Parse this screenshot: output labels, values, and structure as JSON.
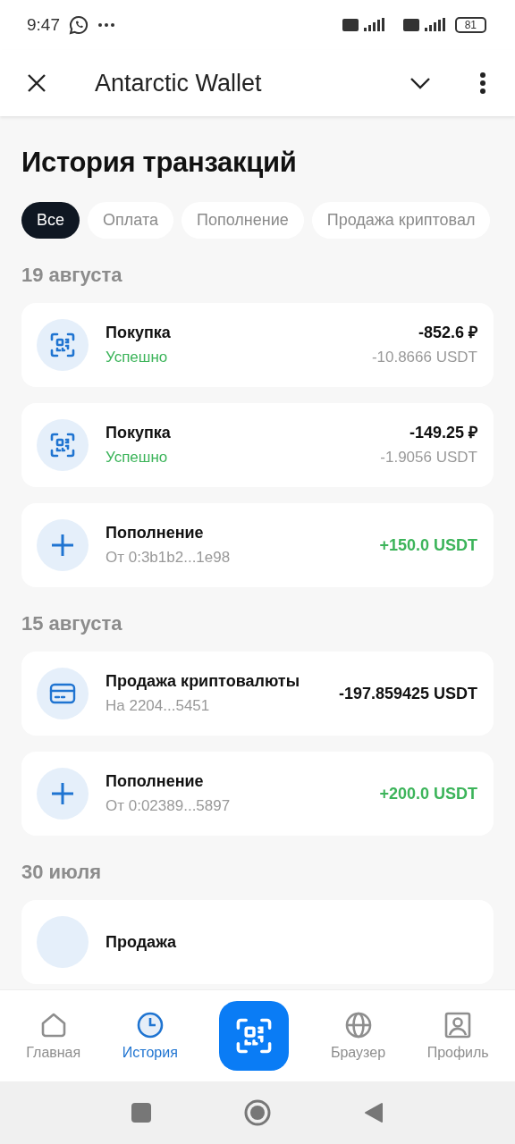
{
  "status_bar": {
    "time": "9:47",
    "battery": "81"
  },
  "app_bar": {
    "title": "Antarctic Wallet"
  },
  "page_title": "История транзакций",
  "filters": [
    {
      "label": "Все",
      "selected": true
    },
    {
      "label": "Оплата",
      "selected": false
    },
    {
      "label": "Пополнение",
      "selected": false
    },
    {
      "label": "Продажа криптовал",
      "selected": false
    }
  ],
  "groups": [
    {
      "date": "19 августа",
      "transactions": [
        {
          "kind": "scan",
          "title": "Покупка",
          "subtitle": "Успешно",
          "subtitle_success": true,
          "amount": "-852.6 ₽",
          "amount_positive": false,
          "secondary_amount": "-10.8666 USDT"
        },
        {
          "kind": "scan",
          "title": "Покупка",
          "subtitle": "Успешно",
          "subtitle_success": true,
          "amount": "-149.25 ₽",
          "amount_positive": false,
          "secondary_amount": "-1.9056 USDT"
        },
        {
          "kind": "plus",
          "title": "Пополнение",
          "subtitle": "От 0:3b1b2...1e98",
          "subtitle_success": false,
          "amount": "+150.0 USDT",
          "amount_positive": true
        }
      ]
    },
    {
      "date": "15 августа",
      "transactions": [
        {
          "kind": "card",
          "title": "Продажа криптовалюты",
          "subtitle": "На 2204...5451",
          "subtitle_success": false,
          "amount": "-197.859425 USDT",
          "amount_positive": false
        },
        {
          "kind": "plus",
          "title": "Пополнение",
          "subtitle": "От 0:02389...5897",
          "subtitle_success": false,
          "amount": "+200.0 USDT",
          "amount_positive": true
        }
      ]
    },
    {
      "date": "30 июля",
      "transactions": [
        {
          "kind": "partial",
          "title": "Продажа"
        }
      ]
    }
  ],
  "bottom_nav": [
    {
      "kind": "home",
      "label": "Главная",
      "selected": false
    },
    {
      "kind": "history",
      "label": "История",
      "selected": true
    },
    {
      "kind": "scan"
    },
    {
      "kind": "globe",
      "label": "Браузер",
      "selected": false
    },
    {
      "kind": "profile",
      "label": "Профиль",
      "selected": false
    }
  ]
}
